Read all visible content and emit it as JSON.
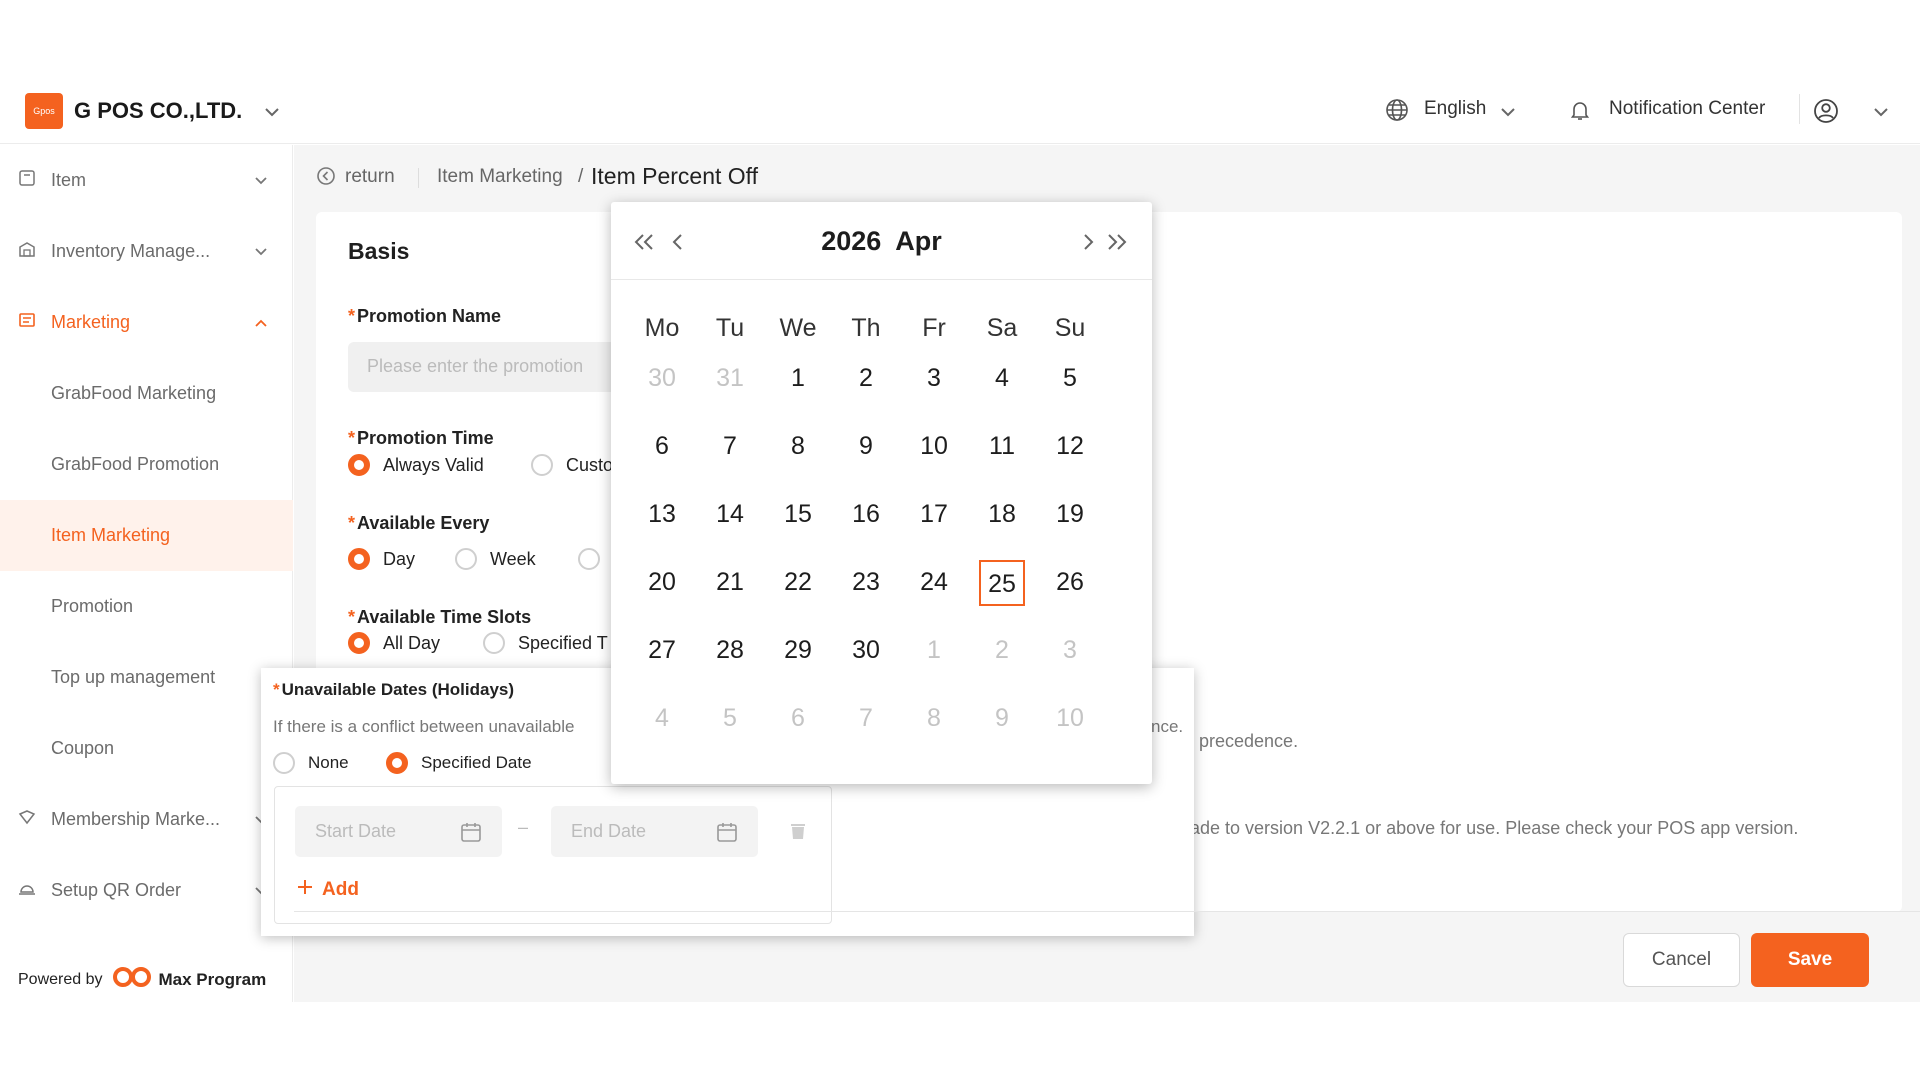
{
  "header": {
    "logo_text": "Gpos",
    "company": "G POS CO.,LTD.",
    "language": "English",
    "notification": "Notification Center"
  },
  "sidebar": {
    "items": [
      {
        "label": "Item"
      },
      {
        "label": "Inventory Manage..."
      },
      {
        "label": "Marketing"
      },
      {
        "label": "GrabFood Marketing"
      },
      {
        "label": "GrabFood Promotion"
      },
      {
        "label": "Item Marketing"
      },
      {
        "label": "Promotion"
      },
      {
        "label": "Top up management"
      },
      {
        "label": "Coupon"
      },
      {
        "label": "Membership Marke..."
      },
      {
        "label": "Setup QR Order"
      }
    ],
    "powered_by": "Powered by",
    "brand": "Max Program"
  },
  "breadcrumb": {
    "return": "return",
    "parent": "Item Marketing",
    "separator": "/",
    "current": "Item Percent Off"
  },
  "form": {
    "section_title": "Basis",
    "required_mark": "*",
    "promotion_name_label": "Promotion Name",
    "promotion_name_placeholder": "Please enter the promotion",
    "promotion_time_label": "Promotion Time",
    "promotion_time_options": [
      "Always Valid",
      "Custo"
    ],
    "available_every_label": "Available Every",
    "available_every_options": [
      "Day",
      "Week"
    ],
    "time_slots_label": "Available Time Slots",
    "time_slots_options": [
      "All Day",
      "Specified T"
    ],
    "bg_text_1": "nce.",
    "bg_text_2": "precedence.",
    "bg_text_3": "ade to version V2.2.1 or above for use. Please check your POS app version."
  },
  "unavailable": {
    "label": "Unavailable Dates (Holidays)",
    "hint": "If there is a conflict between unavailable",
    "options": [
      "None",
      "Specified Date"
    ],
    "start_placeholder": "Start Date",
    "end_placeholder": "End Date",
    "dash": "–",
    "add": "Add"
  },
  "calendar": {
    "year": "2026",
    "month": "Apr",
    "weekdays": [
      "Mo",
      "Tu",
      "We",
      "Th",
      "Fr",
      "Sa",
      "Su"
    ],
    "weeks": [
      [
        "30",
        "31",
        "1",
        "2",
        "3",
        "4",
        "5"
      ],
      [
        "6",
        "7",
        "8",
        "9",
        "10",
        "11",
        "12"
      ],
      [
        "13",
        "14",
        "15",
        "16",
        "17",
        "18",
        "19"
      ],
      [
        "20",
        "21",
        "22",
        "23",
        "24",
        "25",
        "26"
      ],
      [
        "27",
        "28",
        "29",
        "30",
        "1",
        "2",
        "3"
      ],
      [
        "4",
        "5",
        "6",
        "7",
        "8",
        "9",
        "10"
      ]
    ],
    "today": "25"
  },
  "footer": {
    "cancel": "Cancel",
    "save": "Save"
  },
  "colors": {
    "accent": "#f4621f",
    "active_bg": "#fff2eb"
  }
}
